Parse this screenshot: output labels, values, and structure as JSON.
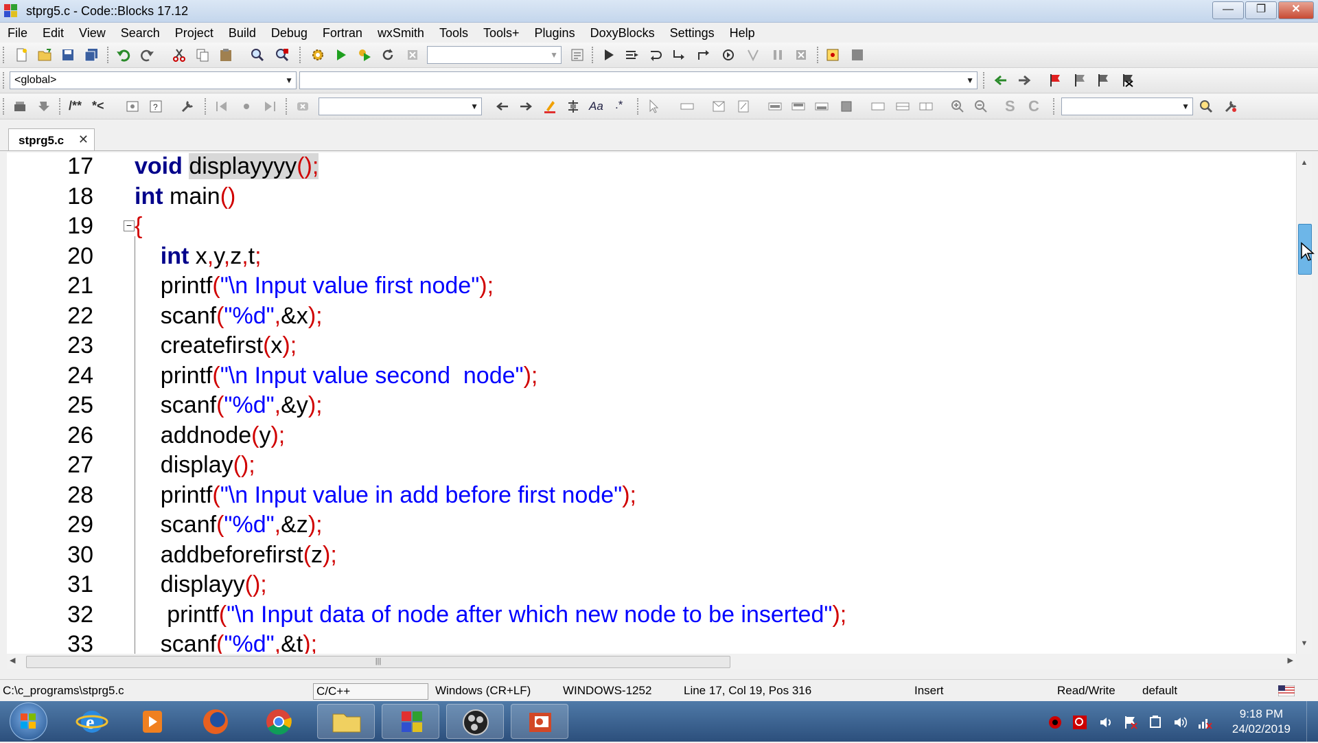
{
  "window": {
    "title": "stprg5.c - Code::Blocks 17.12",
    "buttons": [
      "minimize",
      "restore",
      "close"
    ]
  },
  "menu": [
    "File",
    "Edit",
    "View",
    "Search",
    "Project",
    "Build",
    "Debug",
    "Fortran",
    "wxSmith",
    "Tools",
    "Tools+",
    "Plugins",
    "DoxyBlocks",
    "Settings",
    "Help"
  ],
  "scope_combo": {
    "value": "<global>"
  },
  "function_combo": {
    "value": ""
  },
  "tab": {
    "label": "stprg5.c"
  },
  "doxy": {
    "block_label": "/**",
    "line_label": "*<"
  },
  "code_lines": [
    {
      "n": "17",
      "tokens": [
        [
          "kw",
          "void"
        ],
        [
          "id",
          " "
        ],
        [
          "hl",
          "displayyyy"
        ],
        [
          "hlp",
          "();"
        ]
      ]
    },
    {
      "n": "18",
      "tokens": [
        [
          "kw",
          "int"
        ],
        [
          "id",
          " main"
        ],
        [
          "pun",
          "()"
        ]
      ]
    },
    {
      "n": "19",
      "tokens": [
        [
          "pun",
          "{"
        ]
      ]
    },
    {
      "n": "20",
      "tokens": [
        [
          "id",
          "    "
        ],
        [
          "kw",
          "int"
        ],
        [
          "id",
          " x"
        ],
        [
          "pun",
          ","
        ],
        [
          "id",
          "y"
        ],
        [
          "pun",
          ","
        ],
        [
          "id",
          "z"
        ],
        [
          "pun",
          ","
        ],
        [
          "id",
          "t"
        ],
        [
          "pun",
          ";"
        ]
      ]
    },
    {
      "n": "21",
      "tokens": [
        [
          "id",
          "    printf"
        ],
        [
          "pun",
          "("
        ],
        [
          "str",
          "\"\\n Input value first node\""
        ],
        [
          "pun",
          ");"
        ]
      ]
    },
    {
      "n": "22",
      "tokens": [
        [
          "id",
          "    scanf"
        ],
        [
          "pun",
          "("
        ],
        [
          "str",
          "\"%d\""
        ],
        [
          "pun",
          ","
        ],
        [
          "id",
          "&x"
        ],
        [
          "pun",
          ");"
        ]
      ]
    },
    {
      "n": "23",
      "tokens": [
        [
          "id",
          "    createfirst"
        ],
        [
          "pun",
          "("
        ],
        [
          "id",
          "x"
        ],
        [
          "pun",
          ");"
        ]
      ]
    },
    {
      "n": "24",
      "tokens": [
        [
          "id",
          "    printf"
        ],
        [
          "pun",
          "("
        ],
        [
          "str",
          "\"\\n Input value second  node\""
        ],
        [
          "pun",
          ");"
        ]
      ]
    },
    {
      "n": "25",
      "tokens": [
        [
          "id",
          "    scanf"
        ],
        [
          "pun",
          "("
        ],
        [
          "str",
          "\"%d\""
        ],
        [
          "pun",
          ","
        ],
        [
          "id",
          "&y"
        ],
        [
          "pun",
          ");"
        ]
      ]
    },
    {
      "n": "26",
      "tokens": [
        [
          "id",
          "    addnode"
        ],
        [
          "pun",
          "("
        ],
        [
          "id",
          "y"
        ],
        [
          "pun",
          ");"
        ]
      ]
    },
    {
      "n": "27",
      "tokens": [
        [
          "id",
          "    display"
        ],
        [
          "pun",
          "();"
        ]
      ]
    },
    {
      "n": "28",
      "tokens": [
        [
          "id",
          "    printf"
        ],
        [
          "pun",
          "("
        ],
        [
          "str",
          "\"\\n Input value in add before first node\""
        ],
        [
          "pun",
          ");"
        ]
      ]
    },
    {
      "n": "29",
      "tokens": [
        [
          "id",
          "    scanf"
        ],
        [
          "pun",
          "("
        ],
        [
          "str",
          "\"%d\""
        ],
        [
          "pun",
          ","
        ],
        [
          "id",
          "&z"
        ],
        [
          "pun",
          ");"
        ]
      ]
    },
    {
      "n": "30",
      "tokens": [
        [
          "id",
          "    addbeforefirst"
        ],
        [
          "pun",
          "("
        ],
        [
          "id",
          "z"
        ],
        [
          "pun",
          ");"
        ]
      ]
    },
    {
      "n": "31",
      "tokens": [
        [
          "id",
          "    displayy"
        ],
        [
          "pun",
          "();"
        ]
      ]
    },
    {
      "n": "32",
      "tokens": [
        [
          "id",
          "     printf"
        ],
        [
          "pun",
          "("
        ],
        [
          "str",
          "\"\\n Input data of node after which new node to be inserted\""
        ],
        [
          "pun",
          ");"
        ]
      ]
    },
    {
      "n": "33",
      "tokens": [
        [
          "id",
          "    scanf"
        ],
        [
          "pun",
          "("
        ],
        [
          "str",
          "\"%d\""
        ],
        [
          "pun",
          ","
        ],
        [
          "id",
          "&t"
        ],
        [
          "pun",
          ");"
        ]
      ]
    }
  ],
  "status": {
    "path": "C:\\c_programs\\stprg5.c",
    "language": "C/C++",
    "eol": "Windows (CR+LF)",
    "encoding": "WINDOWS-1252",
    "position": "Line 17, Col 19, Pos 316",
    "mode": "Insert",
    "access": "Read/Write",
    "profile": "default"
  },
  "taskbar": {
    "time": "9:18 PM",
    "date": "24/02/2019"
  },
  "colors": {
    "keyword": "#00008b",
    "string": "#0000ff",
    "punct": "#d00000",
    "highlight": "#d8d8d8"
  }
}
